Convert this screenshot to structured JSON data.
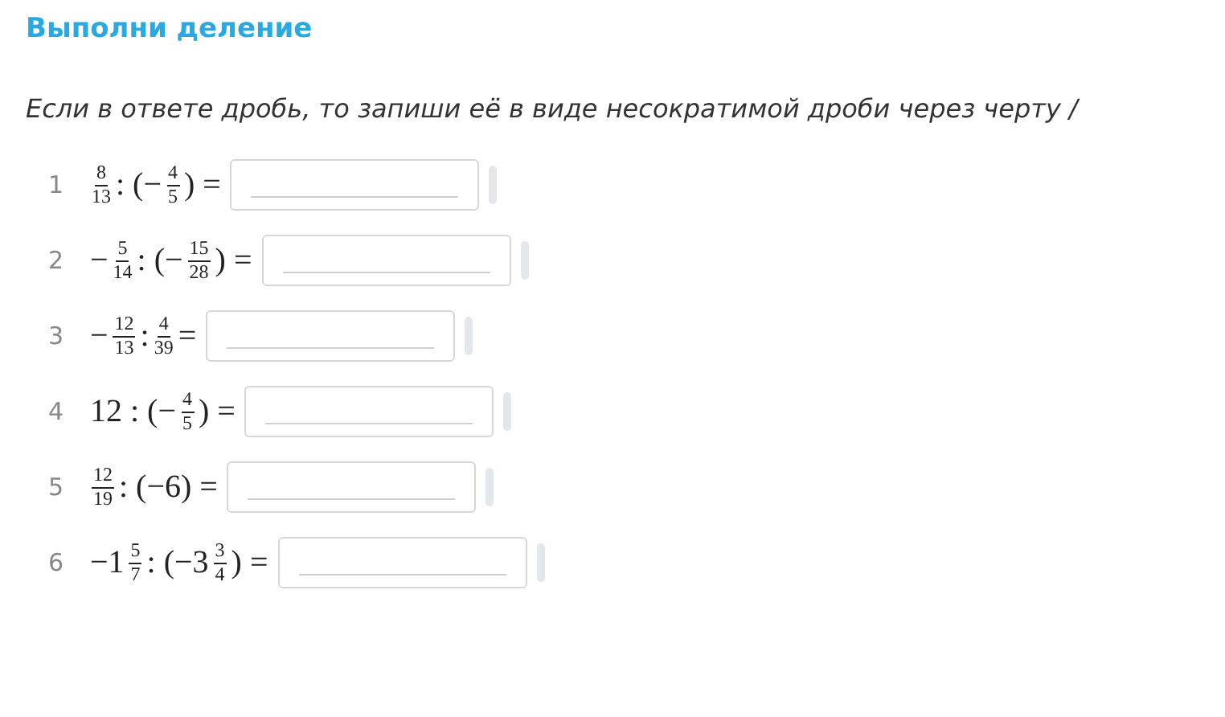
{
  "title": "Выполни деление",
  "instruction": "Если в ответе дробь, то запиши её в виде несократимой дроби через черту /",
  "tasks": [
    {
      "number": "1",
      "expression": [
        {
          "kind": "frac",
          "num": "8",
          "den": "13"
        },
        {
          "kind": "text",
          "text": ": (−"
        },
        {
          "kind": "frac",
          "num": "4",
          "den": "5"
        },
        {
          "kind": "text",
          "text": ") ="
        }
      ]
    },
    {
      "number": "2",
      "expression": [
        {
          "kind": "text",
          "text": "−"
        },
        {
          "kind": "frac",
          "num": "5",
          "den": "14"
        },
        {
          "kind": "text",
          "text": ": (−"
        },
        {
          "kind": "frac",
          "num": "15",
          "den": "28"
        },
        {
          "kind": "text",
          "text": ") ="
        }
      ]
    },
    {
      "number": "3",
      "expression": [
        {
          "kind": "text",
          "text": "−"
        },
        {
          "kind": "frac",
          "num": "12",
          "den": "13"
        },
        {
          "kind": "text",
          "text": ":"
        },
        {
          "kind": "frac",
          "num": "4",
          "den": "39"
        },
        {
          "kind": "text",
          "text": "="
        }
      ]
    },
    {
      "number": "4",
      "expression": [
        {
          "kind": "text",
          "text": "12 : (−"
        },
        {
          "kind": "frac",
          "num": "4",
          "den": "5"
        },
        {
          "kind": "text",
          "text": ") ="
        }
      ]
    },
    {
      "number": "5",
      "expression": [
        {
          "kind": "frac",
          "num": "12",
          "den": "19"
        },
        {
          "kind": "text",
          "text": ": (−6) ="
        }
      ]
    },
    {
      "number": "6",
      "expression": [
        {
          "kind": "text",
          "text": "−1"
        },
        {
          "kind": "frac",
          "num": "5",
          "den": "7"
        },
        {
          "kind": "text",
          "text": ": (−3"
        },
        {
          "kind": "frac",
          "num": "3",
          "den": "4"
        },
        {
          "kind": "text",
          "text": ") ="
        }
      ]
    }
  ]
}
